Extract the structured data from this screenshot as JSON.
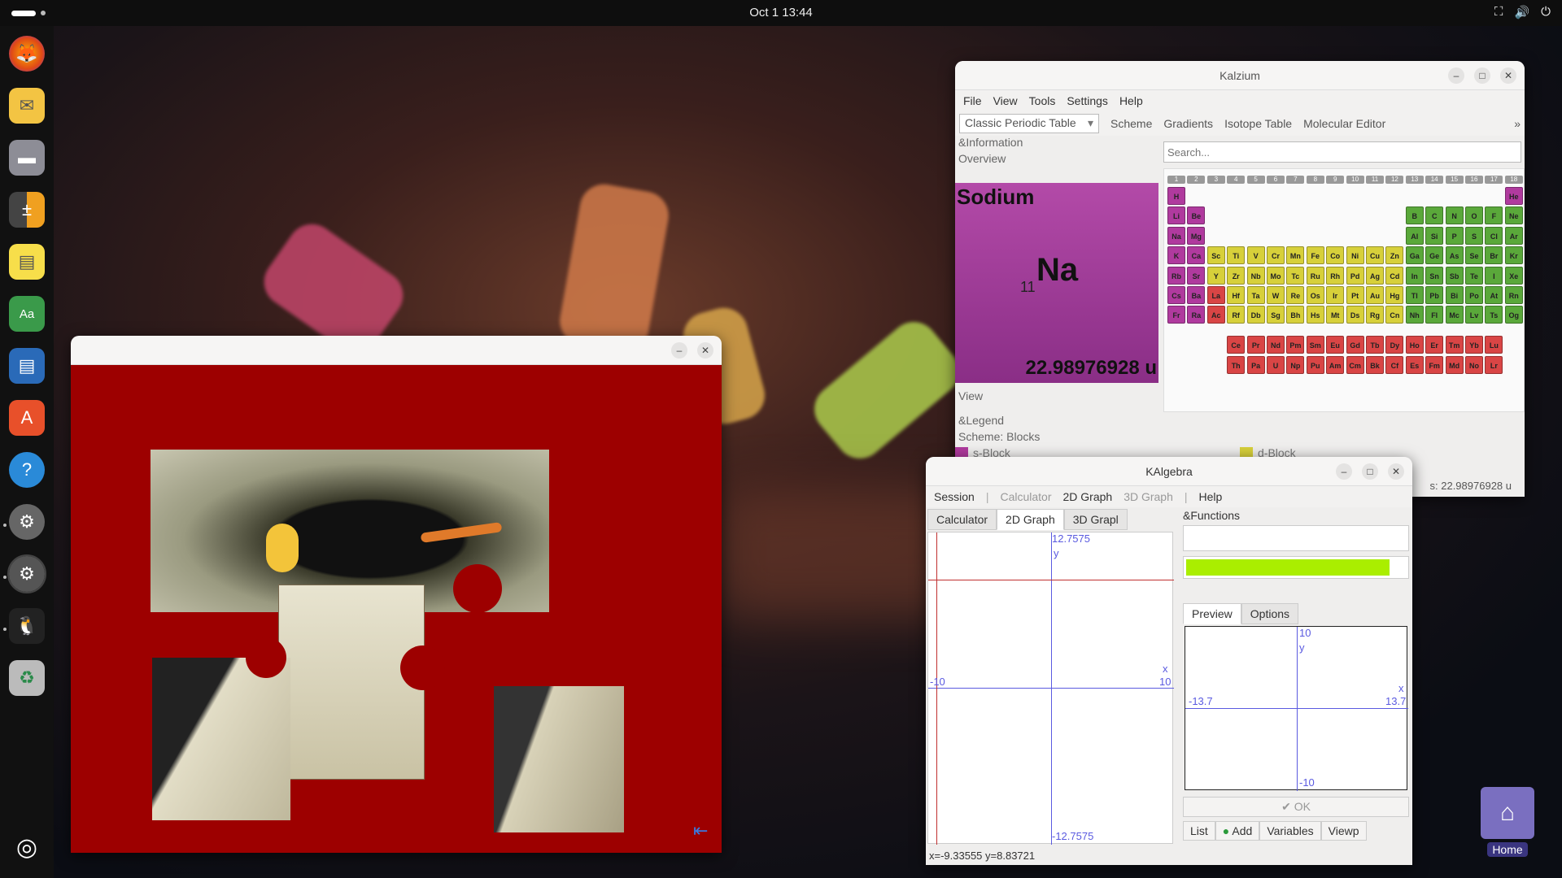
{
  "topbar": {
    "clock": "Oct 1  13:44"
  },
  "dock": {
    "items": [
      "firefox-icon",
      "mail-icon",
      "files-icon",
      "calculator-icon",
      "notes-icon",
      "dictionary-icon",
      "writer-icon",
      "appcenter-icon",
      "help-icon",
      "settings-icon",
      "settings-icon",
      "penguin-app-icon",
      "trash-icon",
      "ubuntu-icon"
    ]
  },
  "desktop": {
    "home_label": "Home"
  },
  "kalzium": {
    "title": "Kalzium",
    "menu": [
      "File",
      "View",
      "Tools",
      "Settings",
      "Help"
    ],
    "table_select": "Classic Periodic Table",
    "toolbar": [
      "Scheme",
      "Gradients",
      "Isotope Table",
      "Molecular Editor"
    ],
    "overflow": "»",
    "info_header": "&Information",
    "overview": "Overview",
    "search_placeholder": "Search...",
    "element": {
      "name": "Sodium",
      "symbol": "Na",
      "number": "11",
      "mass": "22.98976928 u"
    },
    "view_label": "View",
    "legend_header": "&Legend",
    "scheme": "Scheme: Blocks",
    "legend_items": [
      "s-Block",
      "d-Block"
    ],
    "status": "s: 22.98976928 u",
    "groups": [
      "1",
      "2",
      "3",
      "4",
      "5",
      "6",
      "7",
      "8",
      "9",
      "10",
      "11",
      "12",
      "13",
      "14",
      "15",
      "16",
      "17",
      "18"
    ],
    "colors": {
      "s": "#b03a9e",
      "p": "#5aa83a",
      "d": "#d7d03a",
      "f": "#d94545"
    },
    "elements": [
      {
        "s": "H",
        "r": 1,
        "c": 1,
        "b": "s"
      },
      {
        "s": "He",
        "r": 1,
        "c": 18,
        "b": "s"
      },
      {
        "s": "Li",
        "r": 2,
        "c": 1,
        "b": "s"
      },
      {
        "s": "Be",
        "r": 2,
        "c": 2,
        "b": "s"
      },
      {
        "s": "B",
        "r": 2,
        "c": 13,
        "b": "p"
      },
      {
        "s": "C",
        "r": 2,
        "c": 14,
        "b": "p"
      },
      {
        "s": "N",
        "r": 2,
        "c": 15,
        "b": "p"
      },
      {
        "s": "O",
        "r": 2,
        "c": 16,
        "b": "p"
      },
      {
        "s": "F",
        "r": 2,
        "c": 17,
        "b": "p"
      },
      {
        "s": "Ne",
        "r": 2,
        "c": 18,
        "b": "p"
      },
      {
        "s": "Na",
        "r": 3,
        "c": 1,
        "b": "s"
      },
      {
        "s": "Mg",
        "r": 3,
        "c": 2,
        "b": "s"
      },
      {
        "s": "Al",
        "r": 3,
        "c": 13,
        "b": "p"
      },
      {
        "s": "Si",
        "r": 3,
        "c": 14,
        "b": "p"
      },
      {
        "s": "P",
        "r": 3,
        "c": 15,
        "b": "p"
      },
      {
        "s": "S",
        "r": 3,
        "c": 16,
        "b": "p"
      },
      {
        "s": "Cl",
        "r": 3,
        "c": 17,
        "b": "p"
      },
      {
        "s": "Ar",
        "r": 3,
        "c": 18,
        "b": "p"
      },
      {
        "s": "K",
        "r": 4,
        "c": 1,
        "b": "s"
      },
      {
        "s": "Ca",
        "r": 4,
        "c": 2,
        "b": "s"
      },
      {
        "s": "Sc",
        "r": 4,
        "c": 3,
        "b": "d"
      },
      {
        "s": "Ti",
        "r": 4,
        "c": 4,
        "b": "d"
      },
      {
        "s": "V",
        "r": 4,
        "c": 5,
        "b": "d"
      },
      {
        "s": "Cr",
        "r": 4,
        "c": 6,
        "b": "d"
      },
      {
        "s": "Mn",
        "r": 4,
        "c": 7,
        "b": "d"
      },
      {
        "s": "Fe",
        "r": 4,
        "c": 8,
        "b": "d"
      },
      {
        "s": "Co",
        "r": 4,
        "c": 9,
        "b": "d"
      },
      {
        "s": "Ni",
        "r": 4,
        "c": 10,
        "b": "d"
      },
      {
        "s": "Cu",
        "r": 4,
        "c": 11,
        "b": "d"
      },
      {
        "s": "Zn",
        "r": 4,
        "c": 12,
        "b": "d"
      },
      {
        "s": "Ga",
        "r": 4,
        "c": 13,
        "b": "p"
      },
      {
        "s": "Ge",
        "r": 4,
        "c": 14,
        "b": "p"
      },
      {
        "s": "As",
        "r": 4,
        "c": 15,
        "b": "p"
      },
      {
        "s": "Se",
        "r": 4,
        "c": 16,
        "b": "p"
      },
      {
        "s": "Br",
        "r": 4,
        "c": 17,
        "b": "p"
      },
      {
        "s": "Kr",
        "r": 4,
        "c": 18,
        "b": "p"
      },
      {
        "s": "Rb",
        "r": 5,
        "c": 1,
        "b": "s"
      },
      {
        "s": "Sr",
        "r": 5,
        "c": 2,
        "b": "s"
      },
      {
        "s": "Y",
        "r": 5,
        "c": 3,
        "b": "d"
      },
      {
        "s": "Zr",
        "r": 5,
        "c": 4,
        "b": "d"
      },
      {
        "s": "Nb",
        "r": 5,
        "c": 5,
        "b": "d"
      },
      {
        "s": "Mo",
        "r": 5,
        "c": 6,
        "b": "d"
      },
      {
        "s": "Tc",
        "r": 5,
        "c": 7,
        "b": "d"
      },
      {
        "s": "Ru",
        "r": 5,
        "c": 8,
        "b": "d"
      },
      {
        "s": "Rh",
        "r": 5,
        "c": 9,
        "b": "d"
      },
      {
        "s": "Pd",
        "r": 5,
        "c": 10,
        "b": "d"
      },
      {
        "s": "Ag",
        "r": 5,
        "c": 11,
        "b": "d"
      },
      {
        "s": "Cd",
        "r": 5,
        "c": 12,
        "b": "d"
      },
      {
        "s": "In",
        "r": 5,
        "c": 13,
        "b": "p"
      },
      {
        "s": "Sn",
        "r": 5,
        "c": 14,
        "b": "p"
      },
      {
        "s": "Sb",
        "r": 5,
        "c": 15,
        "b": "p"
      },
      {
        "s": "Te",
        "r": 5,
        "c": 16,
        "b": "p"
      },
      {
        "s": "I",
        "r": 5,
        "c": 17,
        "b": "p"
      },
      {
        "s": "Xe",
        "r": 5,
        "c": 18,
        "b": "p"
      },
      {
        "s": "Cs",
        "r": 6,
        "c": 1,
        "b": "s"
      },
      {
        "s": "Ba",
        "r": 6,
        "c": 2,
        "b": "s"
      },
      {
        "s": "La",
        "r": 6,
        "c": 3,
        "b": "f"
      },
      {
        "s": "Hf",
        "r": 6,
        "c": 4,
        "b": "d"
      },
      {
        "s": "Ta",
        "r": 6,
        "c": 5,
        "b": "d"
      },
      {
        "s": "W",
        "r": 6,
        "c": 6,
        "b": "d"
      },
      {
        "s": "Re",
        "r": 6,
        "c": 7,
        "b": "d"
      },
      {
        "s": "Os",
        "r": 6,
        "c": 8,
        "b": "d"
      },
      {
        "s": "Ir",
        "r": 6,
        "c": 9,
        "b": "d"
      },
      {
        "s": "Pt",
        "r": 6,
        "c": 10,
        "b": "d"
      },
      {
        "s": "Au",
        "r": 6,
        "c": 11,
        "b": "d"
      },
      {
        "s": "Hg",
        "r": 6,
        "c": 12,
        "b": "d"
      },
      {
        "s": "Tl",
        "r": 6,
        "c": 13,
        "b": "p"
      },
      {
        "s": "Pb",
        "r": 6,
        "c": 14,
        "b": "p"
      },
      {
        "s": "Bi",
        "r": 6,
        "c": 15,
        "b": "p"
      },
      {
        "s": "Po",
        "r": 6,
        "c": 16,
        "b": "p"
      },
      {
        "s": "At",
        "r": 6,
        "c": 17,
        "b": "p"
      },
      {
        "s": "Rn",
        "r": 6,
        "c": 18,
        "b": "p"
      },
      {
        "s": "Fr",
        "r": 7,
        "c": 1,
        "b": "s"
      },
      {
        "s": "Ra",
        "r": 7,
        "c": 2,
        "b": "s"
      },
      {
        "s": "Ac",
        "r": 7,
        "c": 3,
        "b": "f"
      },
      {
        "s": "Rf",
        "r": 7,
        "c": 4,
        "b": "d"
      },
      {
        "s": "Db",
        "r": 7,
        "c": 5,
        "b": "d"
      },
      {
        "s": "Sg",
        "r": 7,
        "c": 6,
        "b": "d"
      },
      {
        "s": "Bh",
        "r": 7,
        "c": 7,
        "b": "d"
      },
      {
        "s": "Hs",
        "r": 7,
        "c": 8,
        "b": "d"
      },
      {
        "s": "Mt",
        "r": 7,
        "c": 9,
        "b": "d"
      },
      {
        "s": "Ds",
        "r": 7,
        "c": 10,
        "b": "d"
      },
      {
        "s": "Rg",
        "r": 7,
        "c": 11,
        "b": "d"
      },
      {
        "s": "Cn",
        "r": 7,
        "c": 12,
        "b": "d"
      },
      {
        "s": "Nh",
        "r": 7,
        "c": 13,
        "b": "p"
      },
      {
        "s": "Fl",
        "r": 7,
        "c": 14,
        "b": "p"
      },
      {
        "s": "Mc",
        "r": 7,
        "c": 15,
        "b": "p"
      },
      {
        "s": "Lv",
        "r": 7,
        "c": 16,
        "b": "p"
      },
      {
        "s": "Ts",
        "r": 7,
        "c": 17,
        "b": "p"
      },
      {
        "s": "Og",
        "r": 7,
        "c": 18,
        "b": "p"
      },
      {
        "s": "Ce",
        "r": 9,
        "c": 4,
        "b": "f"
      },
      {
        "s": "Pr",
        "r": 9,
        "c": 5,
        "b": "f"
      },
      {
        "s": "Nd",
        "r": 9,
        "c": 6,
        "b": "f"
      },
      {
        "s": "Pm",
        "r": 9,
        "c": 7,
        "b": "f"
      },
      {
        "s": "Sm",
        "r": 9,
        "c": 8,
        "b": "f"
      },
      {
        "s": "Eu",
        "r": 9,
        "c": 9,
        "b": "f"
      },
      {
        "s": "Gd",
        "r": 9,
        "c": 10,
        "b": "f"
      },
      {
        "s": "Tb",
        "r": 9,
        "c": 11,
        "b": "f"
      },
      {
        "s": "Dy",
        "r": 9,
        "c": 12,
        "b": "f"
      },
      {
        "s": "Ho",
        "r": 9,
        "c": 13,
        "b": "f"
      },
      {
        "s": "Er",
        "r": 9,
        "c": 14,
        "b": "f"
      },
      {
        "s": "Tm",
        "r": 9,
        "c": 15,
        "b": "f"
      },
      {
        "s": "Yb",
        "r": 9,
        "c": 16,
        "b": "f"
      },
      {
        "s": "Lu",
        "r": 9,
        "c": 17,
        "b": "f"
      },
      {
        "s": "Th",
        "r": 10,
        "c": 4,
        "b": "f"
      },
      {
        "s": "Pa",
        "r": 10,
        "c": 5,
        "b": "f"
      },
      {
        "s": "U",
        "r": 10,
        "c": 6,
        "b": "f"
      },
      {
        "s": "Np",
        "r": 10,
        "c": 7,
        "b": "f"
      },
      {
        "s": "Pu",
        "r": 10,
        "c": 8,
        "b": "f"
      },
      {
        "s": "Am",
        "r": 10,
        "c": 9,
        "b": "f"
      },
      {
        "s": "Cm",
        "r": 10,
        "c": 10,
        "b": "f"
      },
      {
        "s": "Bk",
        "r": 10,
        "c": 11,
        "b": "f"
      },
      {
        "s": "Cf",
        "r": 10,
        "c": 12,
        "b": "f"
      },
      {
        "s": "Es",
        "r": 10,
        "c": 13,
        "b": "f"
      },
      {
        "s": "Fm",
        "r": 10,
        "c": 14,
        "b": "f"
      },
      {
        "s": "Md",
        "r": 10,
        "c": 15,
        "b": "f"
      },
      {
        "s": "No",
        "r": 10,
        "c": 16,
        "b": "f"
      },
      {
        "s": "Lr",
        "r": 10,
        "c": 17,
        "b": "f"
      }
    ]
  },
  "kalgebra": {
    "title": "KAlgebra",
    "menu": [
      "Session",
      "Calculator",
      "2D Graph",
      "3D Graph",
      "Help"
    ],
    "tabs": [
      "Calculator",
      "2D Graph",
      "3D Grapl"
    ],
    "functions_header": "&Functions",
    "graph_labels": {
      "ymax": "12.7575",
      "ymin": "-12.7575",
      "xmin": "-10",
      "xmax": "10",
      "x": "x",
      "y": "y"
    },
    "preview_tabs": [
      "Preview",
      "Options"
    ],
    "preview_labels": {
      "ymax": "10",
      "ymin": "-10",
      "xmin": "-13.7",
      "xmax": "13.7",
      "x": "x",
      "y": "y"
    },
    "ok": "OK",
    "bottom_tabs": [
      "List",
      "Add",
      "Variables",
      "Viewp"
    ],
    "status": "x=-9.33555 y=8.83721",
    "color": "#aaee00"
  }
}
